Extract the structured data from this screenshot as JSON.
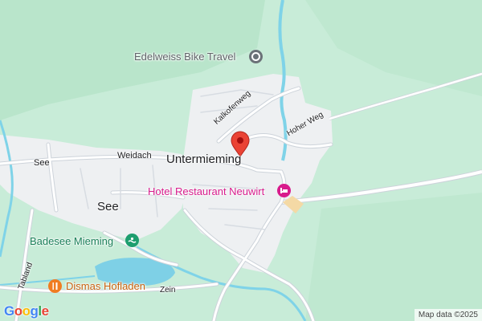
{
  "colors": {
    "land": "#c8ecd8",
    "forest": "#b4e2c6",
    "settlement": "#eef0f2",
    "road": "#ffffff",
    "road_edge": "#cdd3da",
    "water": "#7fd3e8",
    "lake": "#7ed0e6",
    "marker": "#ea4335",
    "hotel_pink": "#d81b8c",
    "poi_grey": "#6b7278",
    "poi_green": "#1e9e6f",
    "food_orange": "#f07c21"
  },
  "places": {
    "untermieming": "Untermieming",
    "see_town": "See"
  },
  "streets": {
    "kalkofenweg": "Kalkofenweg",
    "hoher_weg": "Hoher Weg",
    "weidach": "Weidach",
    "see_road": "See",
    "tabland": "Tabland",
    "zein": "Zein"
  },
  "pois": {
    "edelweiss": {
      "name": "Edelweiss Bike Travel",
      "icon": "location-dot-icon"
    },
    "hotel": {
      "name": "Hotel Restaurant Neuwirt",
      "icon": "bed-icon"
    },
    "badesee": {
      "name": "Badesee Mieming",
      "icon": "pool-icon"
    },
    "dismas": {
      "name": "Dismas Hofladen",
      "icon": "fork-knife-icon"
    }
  },
  "marker": {
    "icon": "map-pin-icon"
  },
  "logo": {
    "text": "Google"
  },
  "attribution": "Map data ©2025"
}
